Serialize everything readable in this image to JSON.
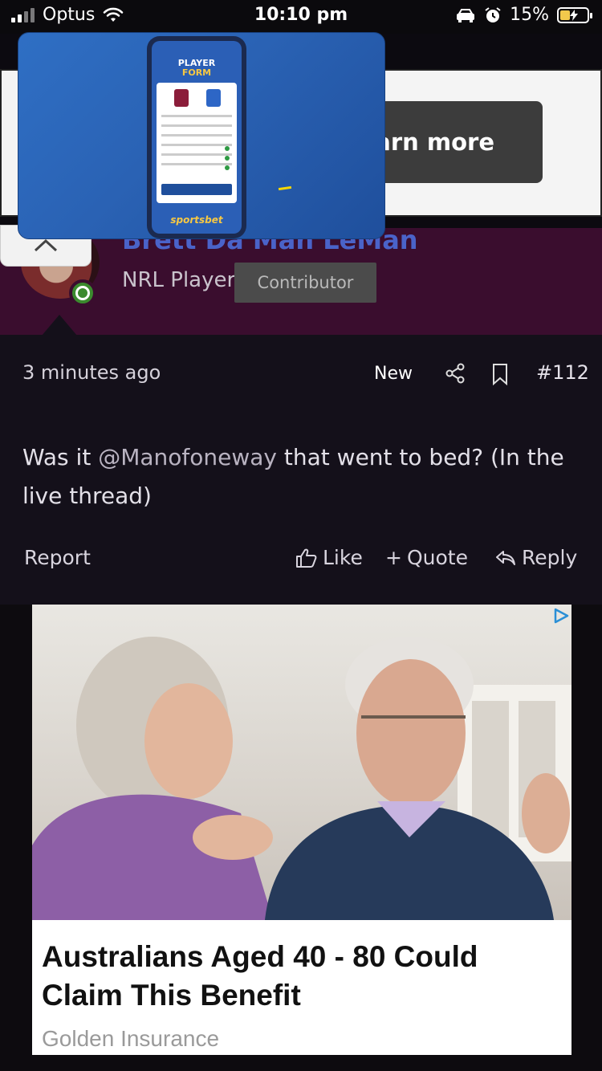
{
  "status_bar": {
    "carrier": "Optus",
    "time": "10:10 pm",
    "battery_percent": "15%",
    "battery_level": 0.15,
    "icons": [
      "signal-icon",
      "wifi-icon",
      "car-icon",
      "alarm-icon",
      "battery-charging-icon"
    ]
  },
  "ad_top": {
    "button_label": "earn more"
  },
  "pip_video": {
    "title_line1": "PLAYER",
    "title_line2": "FORM",
    "brand": "sportsbet"
  },
  "post": {
    "author_name": "Brett Da Man LeMan",
    "author_role": "NRL Player",
    "author_badge": "Contributor",
    "timestamp": "3 minutes ago",
    "new_label": "New",
    "post_number": "#112",
    "content_prefix": "Was it ",
    "content_mention": "@Manofoneway",
    "content_suffix": " that went to bed? (In the live thread)",
    "actions": {
      "report": "Report",
      "like": "Like",
      "quote": "Quote",
      "reply": "Reply"
    }
  },
  "ad_bottom": {
    "headline": "Australians Aged 40 - 80 Could Claim This Benefit",
    "source": "Golden Insurance"
  },
  "colors": {
    "post_header_bg": "#3a0d2e",
    "post_body_bg": "#14101a",
    "username": "#4a63c9",
    "online": "#3b8a2e",
    "badge_bg": "#4b4b4b"
  }
}
